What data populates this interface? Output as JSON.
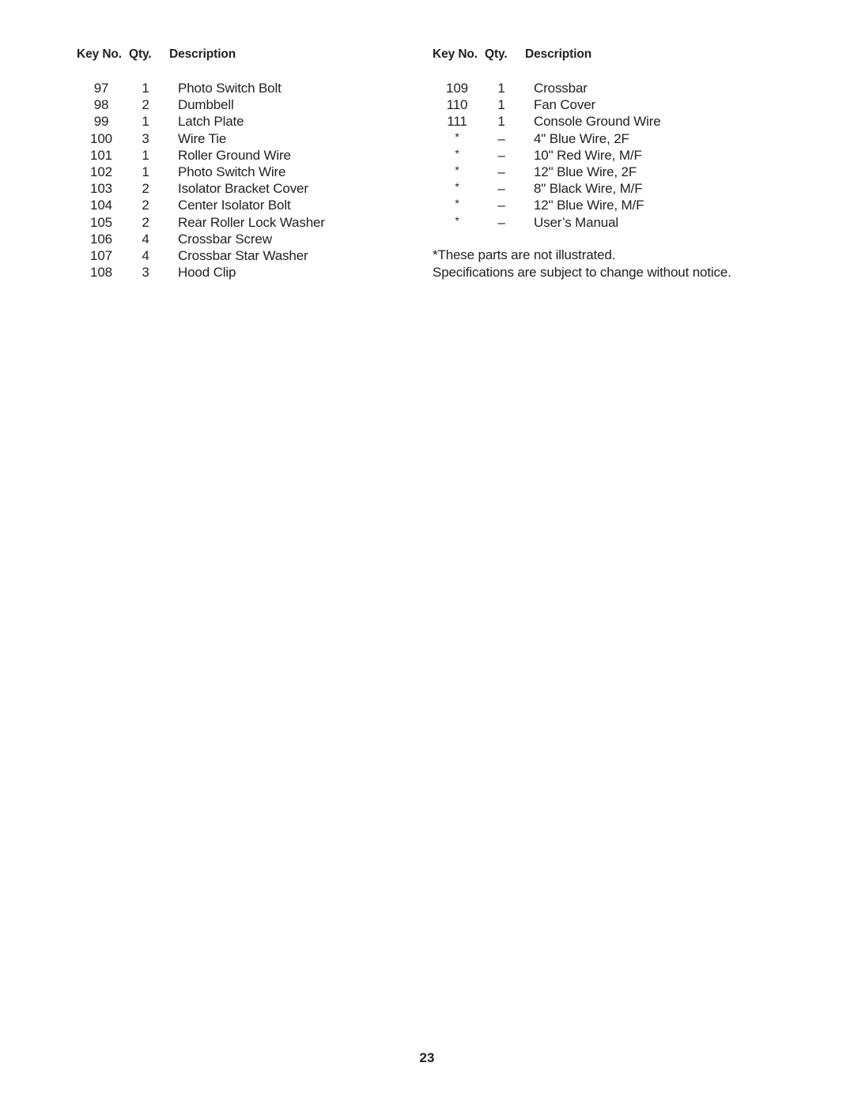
{
  "document": {
    "page_number": "23"
  },
  "columns": [
    {
      "headers": {
        "key_no": "Key No.",
        "qty": "Qty.",
        "description": "Description"
      },
      "rows": [
        {
          "key_no": "97",
          "qty": "1",
          "description": "Photo Switch Bolt"
        },
        {
          "key_no": "98",
          "qty": "2",
          "description": "Dumbbell"
        },
        {
          "key_no": "99",
          "qty": "1",
          "description": "Latch Plate"
        },
        {
          "key_no": "100",
          "qty": "3",
          "description": "Wire Tie"
        },
        {
          "key_no": "101",
          "qty": "1",
          "description": "Roller Ground Wire"
        },
        {
          "key_no": "102",
          "qty": "1",
          "description": "Photo Switch Wire"
        },
        {
          "key_no": "103",
          "qty": "2",
          "description": "Isolator Bracket Cover"
        },
        {
          "key_no": "104",
          "qty": "2",
          "description": "Center Isolator Bolt"
        },
        {
          "key_no": "105",
          "qty": "2",
          "description": "Rear Roller Lock Washer"
        },
        {
          "key_no": "106",
          "qty": "4",
          "description": "Crossbar Screw"
        },
        {
          "key_no": "107",
          "qty": "4",
          "description": "Crossbar Star Washer"
        },
        {
          "key_no": "108",
          "qty": "3",
          "description": "Hood Clip"
        }
      ]
    },
    {
      "headers": {
        "key_no": "Key No.",
        "qty": "Qty.",
        "description": "Description"
      },
      "rows": [
        {
          "key_no": "109",
          "qty": "1",
          "description": "Crossbar"
        },
        {
          "key_no": "110",
          "qty": "1",
          "description": "Fan Cover"
        },
        {
          "key_no": "111",
          "qty": "1",
          "description": "Console Ground Wire"
        },
        {
          "key_no": "*",
          "qty": "–",
          "description": "4\" Blue Wire, 2F"
        },
        {
          "key_no": "*",
          "qty": "–",
          "description": "10\" Red Wire, M/F"
        },
        {
          "key_no": "*",
          "qty": "–",
          "description": "12\" Blue Wire, 2F"
        },
        {
          "key_no": "*",
          "qty": "–",
          "description": "8\" Black Wire, M/F"
        },
        {
          "key_no": "*",
          "qty": "–",
          "description": "12\" Blue Wire, M/F"
        },
        {
          "key_no": "*",
          "qty": "–",
          "description": "User’s Manual"
        }
      ]
    }
  ],
  "footnotes": [
    "*These parts are not illustrated.",
    "Specifications are subject to change without notice."
  ]
}
